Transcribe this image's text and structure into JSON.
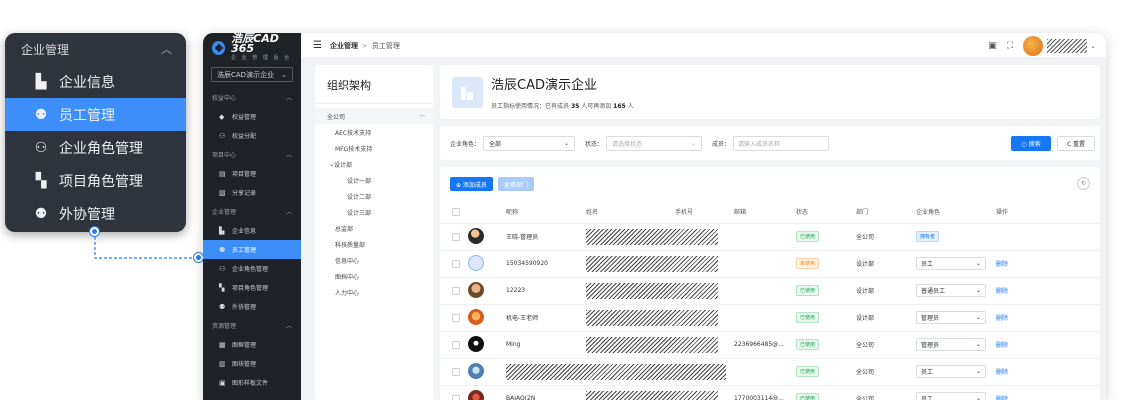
{
  "callout": {
    "header": "企业管理",
    "items": [
      {
        "label": "企业信息",
        "icon": "building-icon"
      },
      {
        "label": "员工管理",
        "icon": "user-icon",
        "active": true
      },
      {
        "label": "企业角色管理",
        "icon": "user-group-icon"
      },
      {
        "label": "项目角色管理",
        "icon": "project-role-icon"
      },
      {
        "label": "外协管理",
        "icon": "external-user-icon"
      }
    ]
  },
  "app": {
    "logo_title": "浩辰CAD 365",
    "logo_sub": "企 业 管 理 后 台",
    "company_select": "浩辰CAD演示企业",
    "sidebar": [
      {
        "type": "group",
        "label": "权益中心"
      },
      {
        "type": "item",
        "label": "权益管理",
        "icon": "diamond-icon"
      },
      {
        "type": "item",
        "label": "权益分配",
        "icon": "share-icon"
      },
      {
        "type": "group",
        "label": "项目中心"
      },
      {
        "type": "item",
        "label": "项目管理",
        "icon": "folder-icon"
      },
      {
        "type": "item",
        "label": "分享记录",
        "icon": "record-icon"
      },
      {
        "type": "group",
        "label": "企业管理"
      },
      {
        "type": "item",
        "label": "企业信息",
        "icon": "building-icon"
      },
      {
        "type": "item",
        "label": "员工管理",
        "icon": "user-icon",
        "active": true
      },
      {
        "type": "item",
        "label": "企业角色管理",
        "icon": "user-group-icon"
      },
      {
        "type": "item",
        "label": "项目角色管理",
        "icon": "project-role-icon"
      },
      {
        "type": "item",
        "label": "外协管理",
        "icon": "external-user-icon"
      },
      {
        "type": "group",
        "label": "资源管理"
      },
      {
        "type": "item",
        "label": "图框管理",
        "icon": "frame-icon"
      },
      {
        "type": "item",
        "label": "图块管理",
        "icon": "block-icon"
      },
      {
        "type": "item",
        "label": "图形样板文件",
        "icon": "template-icon"
      }
    ],
    "breadcrumb": {
      "first": "企业管理",
      "sep": ">",
      "second": "员工管理"
    }
  },
  "org": {
    "title": "组织架构",
    "root": "全公司",
    "root_more": "···",
    "nodes": [
      {
        "label": "AEC技术支持",
        "level": 1
      },
      {
        "label": "MFG技术支持",
        "level": 1
      },
      {
        "label": "设计部",
        "level": 0,
        "expanded": true
      },
      {
        "label": "设计一部",
        "level": 2
      },
      {
        "label": "设计二部",
        "level": 2
      },
      {
        "label": "设计三部",
        "level": 2
      },
      {
        "label": "总监部",
        "level": 1
      },
      {
        "label": "科技质量部",
        "level": 1
      },
      {
        "label": "信息中心",
        "level": 1
      },
      {
        "label": "图档中心",
        "level": 1
      },
      {
        "label": "人力中心",
        "level": 1
      }
    ]
  },
  "company": {
    "name": "浩辰CAD演示企业",
    "usage_prefix": "员工指标使用情况：已有成员",
    "members": "35",
    "usage_mid": "人可再添加",
    "remaining": "165",
    "usage_suffix": "人"
  },
  "filter": {
    "role_label": "企业角色：",
    "role_value": "全部",
    "status_label": "状态：",
    "status_placeholder": "请选择状态",
    "member_label": "成员：",
    "member_placeholder": "请输入成员名称",
    "search_label": "○ 搜索",
    "reset_label": "C 重置"
  },
  "table": {
    "add_label": "⊕ 添加成员",
    "dept_label": "更换部门",
    "columns": [
      "",
      "",
      "昵称",
      "姓名",
      "手机号",
      "邮箱",
      "状态",
      "部门",
      "企业角色",
      "操作"
    ],
    "rows": [
      {
        "avatar": "a",
        "nick": "王晓-管理员",
        "email": "",
        "status": "已使用",
        "status_color": "green",
        "dept": "全公司",
        "role": "拥有者",
        "role_tag": true,
        "action": ""
      },
      {
        "avatar": "b",
        "nick": "15034590920",
        "email": "",
        "status": "未使用",
        "status_color": "orange",
        "dept": "设计部",
        "role": "员工",
        "role_tag": false,
        "action": "删除"
      },
      {
        "avatar": "c",
        "nick": "12223",
        "email": "",
        "status": "已使用",
        "status_color": "green",
        "dept": "设计部",
        "role": "普通员工",
        "role_tag": false,
        "action": "删除"
      },
      {
        "avatar": "d",
        "nick": "机电-王老师",
        "email": "",
        "status": "已使用",
        "status_color": "green",
        "dept": "设计部",
        "role": "管理员",
        "role_tag": false,
        "action": "删除"
      },
      {
        "avatar": "e",
        "nick": "Ming",
        "email": "2236966485@...",
        "status": "已使用",
        "status_color": "green",
        "dept": "全公司",
        "role": "管理员",
        "role_tag": false,
        "action": "删除"
      },
      {
        "avatar": "f",
        "nick": "",
        "email": "",
        "status": "已使用",
        "status_color": "green",
        "dept": "全公司",
        "role": "员工",
        "role_tag": false,
        "action": "删除",
        "wide_hatch": true
      },
      {
        "avatar": "g",
        "nick": "BAIAO(2N",
        "email": "1770003114@...",
        "status": "已使用",
        "status_color": "green",
        "dept": "全公司",
        "role": "员工",
        "role_tag": false,
        "action": "删除"
      }
    ]
  }
}
